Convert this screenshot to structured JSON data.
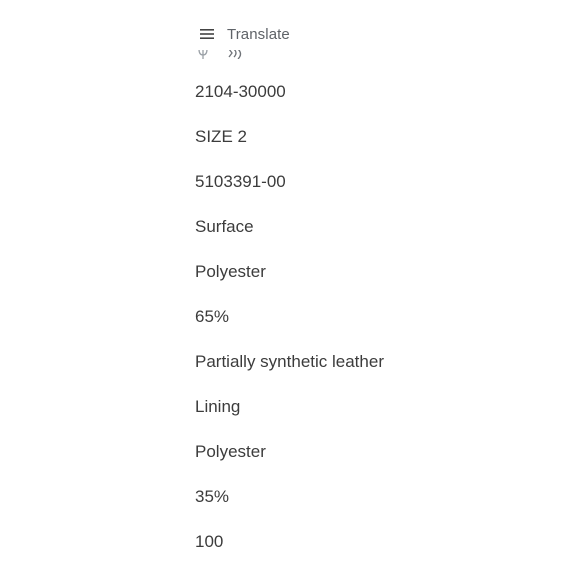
{
  "app_bar": {
    "title": "Translate",
    "menu_icon": "hamburger-menu-icon"
  },
  "partial_toolbar_icons": [
    "microphone-icon",
    "speaker-icon"
  ],
  "result_lines": [
    "2104-30000",
    "SIZE 2",
    "5103391-00",
    "Surface",
    "Polyester",
    "65%",
    "Partially synthetic leather",
    "Lining",
    "Polyester",
    "35%",
    "100"
  ]
}
